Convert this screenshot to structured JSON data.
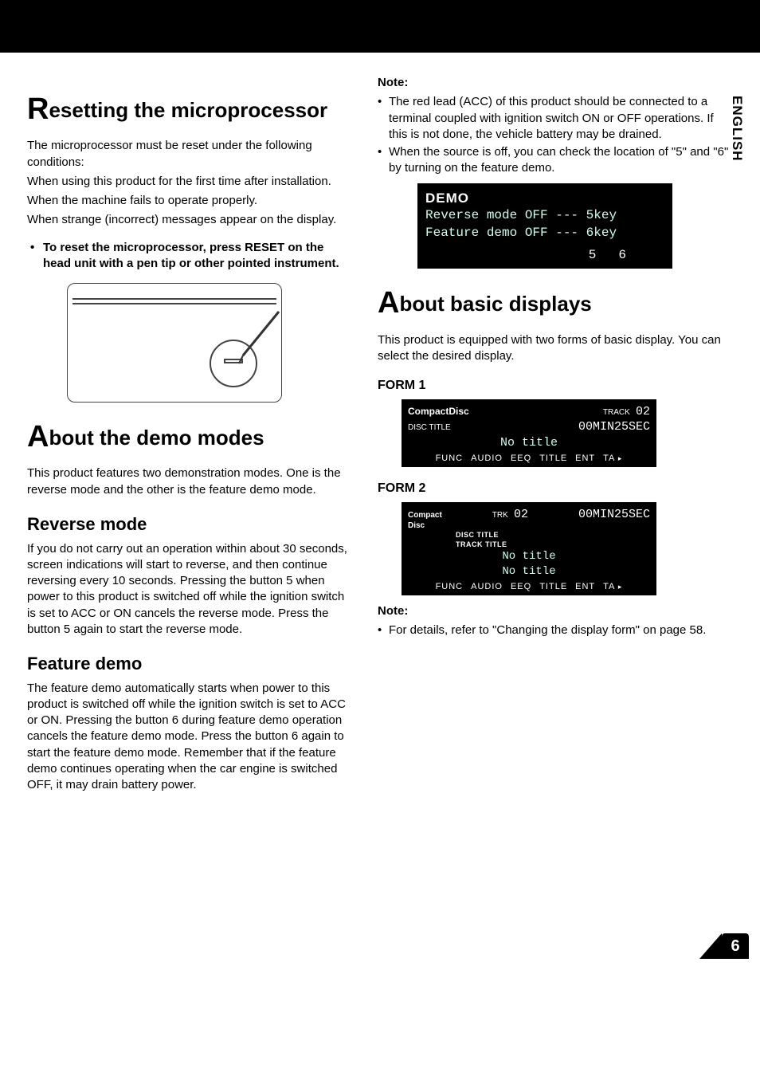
{
  "language_tab": "ENGLISH",
  "page_number": "6",
  "left": {
    "h1a": "esetting the microprocessor",
    "p1": "The microprocessor must be reset under the following conditions:",
    "p2": "When using this product for the first time after installation.",
    "p3": "When the machine fails to operate properly.",
    "p4": "When strange (incorrect) messages appear on the display.",
    "reset_instruction": "To reset the microprocessor, press RESET on the head unit with a pen tip or other pointed instrument.",
    "h1b": "bout the demo modes",
    "p5": "This product features two demonstration modes. One is the reverse mode and the other is the feature demo mode.",
    "h2a": "Reverse mode",
    "p6": "If you do not carry out an operation within about 30 seconds, screen indications will start to reverse, and then continue reversing every 10 seconds. Pressing the button 5 when power to this product is switched off while the ignition switch is set to ACC or ON cancels the reverse mode. Press the button 5 again to start the reverse mode.",
    "h2b": "Feature demo",
    "p7": "The feature demo automatically starts when power to this product is switched off while the ignition switch is set to ACC or ON. Pressing the button 6 during feature demo operation cancels the feature demo mode. Press the button 6 again to start the feature demo mode. Remember that if the feature demo continues operating when the car engine is switched OFF, it may drain battery power."
  },
  "right": {
    "note1_label": "Note:",
    "note1_items": [
      "The red lead (ACC) of this product should be connected to a terminal coupled with ignition switch ON or OFF operations. If this is not done, the vehicle battery may be drained.",
      "When the source is off, you can check the location of \"5\" and \"6\" by turning on the feature demo."
    ],
    "lcd": {
      "header": "DEMO",
      "line1": "Reverse mode OFF --- 5key",
      "line2": "Feature demo OFF --- 6key",
      "digits": "56"
    },
    "h1c": "bout basic displays",
    "p8": "This product is equipped with two forms of basic display. You can select the desired display.",
    "form1_label": "FORM 1",
    "form2_label": "FORM 2",
    "display1": {
      "top_left": "CompactDisc",
      "disc_title": "DISC TITLE",
      "track": "TRACK",
      "trk_num": "02",
      "time": "00MIN25SEC",
      "center_text": "No title",
      "bottom": [
        "FUNC",
        "AUDIO",
        "EEQ",
        "TITLE",
        "ENT",
        "TA"
      ]
    },
    "display2": {
      "top_left": "Compact\nDisc",
      "trk_label": "TRK",
      "trk_num": "02",
      "time": "00MIN25SEC",
      "disc_title_label": "DISC TITLE",
      "track_title_label": "TRACK TITLE",
      "row1": "No title",
      "row2": "No title",
      "bottom": [
        "FUNC",
        "AUDIO",
        "EEQ",
        "TITLE",
        "ENT",
        "TA"
      ]
    },
    "note2_label": "Note:",
    "note2_items": [
      "For details, refer to \"Changing the display form\" on page 58."
    ]
  }
}
